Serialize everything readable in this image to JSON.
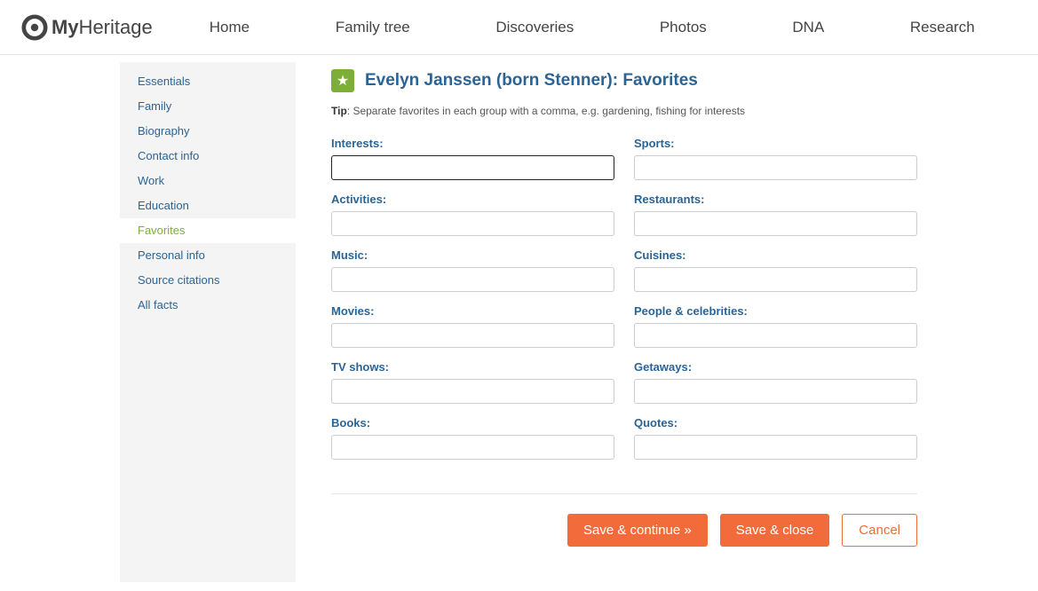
{
  "logo": {
    "brand": "My",
    "brand2": "Heritage"
  },
  "nav": {
    "home": "Home",
    "family_tree": "Family tree",
    "discoveries": "Discoveries",
    "photos": "Photos",
    "dna": "DNA",
    "research": "Research"
  },
  "sidebar": {
    "items": {
      "essentials": "Essentials",
      "family": "Family",
      "biography": "Biography",
      "contact": "Contact info",
      "work": "Work",
      "education": "Education",
      "favorites": "Favorites",
      "personal": "Personal info",
      "sources": "Source citations",
      "allfacts": "All facts"
    }
  },
  "page": {
    "title": "Evelyn Janssen (born Stenner): Favorites",
    "tip_label": "Tip",
    "tip_text": ": Separate favorites in each group with a comma, e.g. gardening, fishing for interests"
  },
  "fields": {
    "interests": "Interests:",
    "sports": "Sports:",
    "activities": "Activities:",
    "restaurants": "Restaurants:",
    "music": "Music:",
    "cuisines": "Cuisines:",
    "movies": "Movies:",
    "people": "People & celebrities:",
    "tvshows": "TV shows:",
    "getaways": "Getaways:",
    "books": "Books:",
    "quotes": "Quotes:"
  },
  "buttons": {
    "save_continue": "Save & continue »",
    "save_close": "Save & close",
    "cancel": "Cancel"
  }
}
